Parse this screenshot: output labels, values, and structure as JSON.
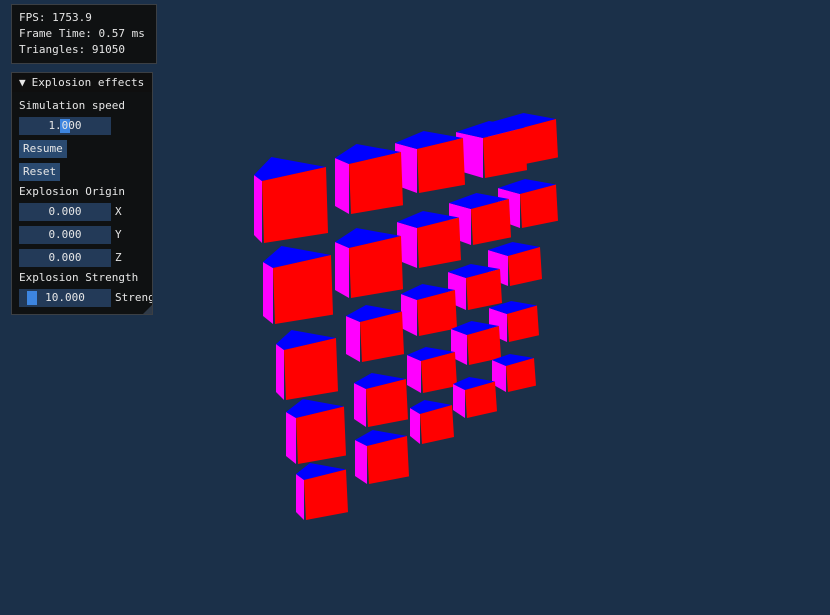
{
  "stats": {
    "fps": "FPS: 1753.9",
    "frame_time": "Frame Time: 0.57 ms",
    "triangles": "Triangles: 91050"
  },
  "panel": {
    "title": "Explosion effects",
    "collapse_arrow": "▼",
    "sim_speed_label": "Simulation speed",
    "sim_speed_value": "1.000",
    "sim_speed_fraction": 0.5,
    "resume_label": "Resume",
    "reset_label": "Reset",
    "origin_label": "Explosion Origin",
    "origin": [
      {
        "value": "0.000",
        "axis": "X"
      },
      {
        "value": "0.000",
        "axis": "Y"
      },
      {
        "value": "0.000",
        "axis": "Z"
      }
    ],
    "strength_label": "Explosion Strength",
    "strength_value": "10.000",
    "strength_suffix": "Strength",
    "strength_fraction": 0.1
  },
  "colors": {
    "background": "#1b3049",
    "cube_top": "#0000ff",
    "cube_front": "#ff0000",
    "cube_side": "#ff00ff",
    "widget_bg": "#233a58",
    "slider_grab": "#3d85e0"
  }
}
